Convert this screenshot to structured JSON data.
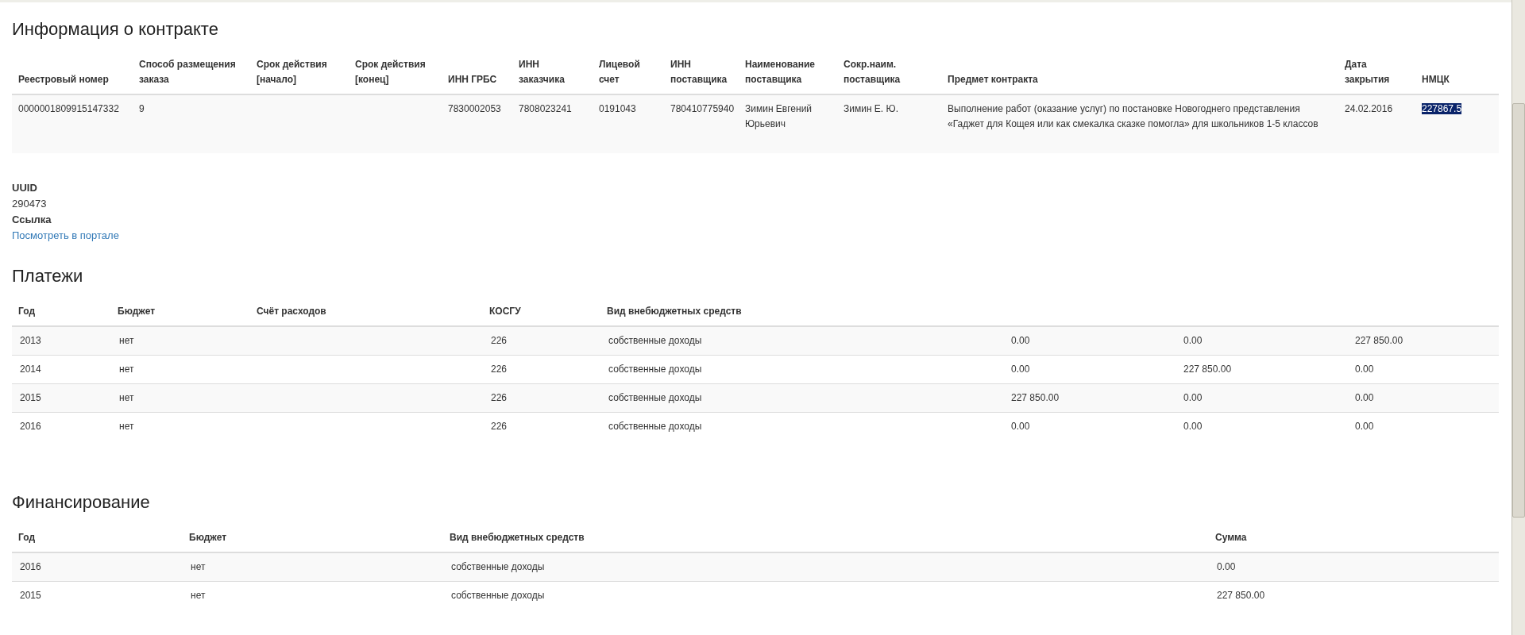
{
  "contract": {
    "title": "Информация о контракте",
    "columns": [
      "Реестровый номер",
      "Способ размещения заказа",
      "Срок действия [начало]",
      "Срок действия [конец]",
      "ИНН ГРБС",
      "ИНН заказчика",
      "Лицевой счет",
      "ИНН поставщика",
      "Наименование поставщика",
      "Сокр.наим. поставщика",
      "Предмет контракта",
      "Дата закрытия",
      "НМЦК"
    ],
    "rows": [
      {
        "cells": [
          {
            "text": "0000001809915147332",
            "selected": false
          },
          {
            "text": "9",
            "selected": false
          },
          null,
          null,
          {
            "text": "7830002053",
            "selected": false
          },
          {
            "text": "7808023241",
            "selected": false
          },
          {
            "text": "0191043",
            "selected": false
          },
          {
            "text": "780410775940",
            "selected": false
          },
          {
            "text": "Зимин Евгений Юрьевич",
            "selected": false
          },
          {
            "text": "Зимин Е. Ю.",
            "selected": false
          },
          {
            "text": "Выполнение работ (оказание услуг) по постановке Новогоднего представления «Гаджет для Кощея или как смекалка сказке помогла» для школьников 1-5 классов",
            "selected": false
          },
          {
            "text": "24.02.2016",
            "selected": false
          },
          {
            "text": "227867.5",
            "selected": true
          }
        ]
      }
    ]
  },
  "details": [
    {
      "label": "UUID",
      "value": "290473",
      "kind": "text"
    },
    {
      "label": "Ссылка",
      "value": "Посмотреть в портале",
      "kind": "link"
    }
  ],
  "payments": {
    "title": "Платежи",
    "columns": [
      "Год",
      "Бюджет",
      "Счёт расходов",
      "КОСГУ",
      "Вид внебюджетных средств",
      null,
      null,
      null
    ],
    "rows": [
      [
        "2013",
        "нет",
        null,
        "226",
        "собственные доходы",
        "0.00",
        "0.00",
        "227 850.00"
      ],
      [
        "2014",
        "нет",
        null,
        "226",
        "собственные доходы",
        "0.00",
        "227 850.00",
        "0.00"
      ],
      [
        "2015",
        "нет",
        null,
        "226",
        "собственные доходы",
        "227 850.00",
        "0.00",
        "0.00"
      ],
      [
        "2016",
        "нет",
        null,
        "226",
        "собственные доходы",
        "0.00",
        "0.00",
        "0.00"
      ]
    ]
  },
  "financing": {
    "title": "Финансирование",
    "columns": [
      "Год",
      "Бюджет",
      "Вид внебюджетных средств",
      "Сумма"
    ],
    "rows": [
      [
        "2016",
        "нет",
        "собственные доходы",
        "0.00"
      ],
      [
        "2015",
        "нет",
        "собственные доходы",
        "227 850.00"
      ]
    ]
  }
}
